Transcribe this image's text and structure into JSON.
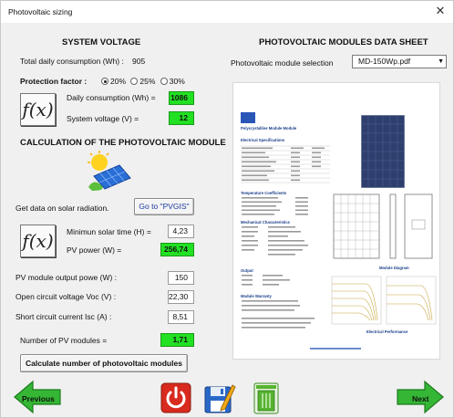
{
  "window": {
    "title": "Photovoltaic sizing"
  },
  "left": {
    "system_voltage_heading": "SYSTEM VOLTAGE",
    "total_daily_label": "Total daily consumption (Wh) :",
    "total_daily_value": "905",
    "protection_label": "Protection factor :",
    "protection_options": [
      "20%",
      "25%",
      "30%"
    ],
    "protection_selected": "20%",
    "daily_consumption_label": "Daily consumption (Wh) =",
    "daily_consumption_value": "1086",
    "system_voltage_label": "System voltage (V) =",
    "system_voltage_value": "12",
    "calc_heading": "CALCULATION OF THE PHOTOVOLTAIC MODULE",
    "solar_label": "Get data on solar radiation.",
    "pvgis_button": "Go to \"PVGIS\"",
    "min_solar_label": "Minimun solar time (H) =",
    "min_solar_value": "4,23",
    "pv_power_label": "PV power (W) =",
    "pv_power_value": "256,74",
    "output_power_label": "PV module output powe (W) :",
    "output_power_value": "150",
    "voc_label": "Open circuit voltage Voc (V) :",
    "voc_value": "22,30",
    "isc_label": "Short circuit current Isc (A) :",
    "isc_value": "8,51",
    "num_modules_label": "Number of PV modules =",
    "num_modules_value": "1,71",
    "calc_button": "Calculate number of photovoltaic modules",
    "fx_symbol": "f(x)"
  },
  "right": {
    "heading": "PHOTOVOLTAIC MODULES DATA SHEET",
    "selection_label": "Photovoltaic module selection",
    "selection_value": "MD-150Wp.pdf"
  },
  "datasheet": {
    "product_title": "Polycrystalline Module Module",
    "electrical_heading": "Electrical Specifications",
    "temperature_heading": "Temperature Coefficients",
    "mechanical_heading": "Mechanical Characteristics",
    "output_heading": "Output",
    "warranty_heading": "Module Warranty",
    "diagram_caption": "Module Diagram",
    "performance_caption": "Electrical Performance"
  },
  "footer": {
    "previous_label": "Previous",
    "next_label": "Next"
  },
  "icons": {
    "power": "power-icon",
    "save": "save-icon",
    "trash": "trash-icon",
    "solar": "solar-panel-icon"
  },
  "colors": {
    "green_field": "#22e022",
    "arrow_green": "#2fb62f",
    "power_red": "#d82a1e"
  }
}
